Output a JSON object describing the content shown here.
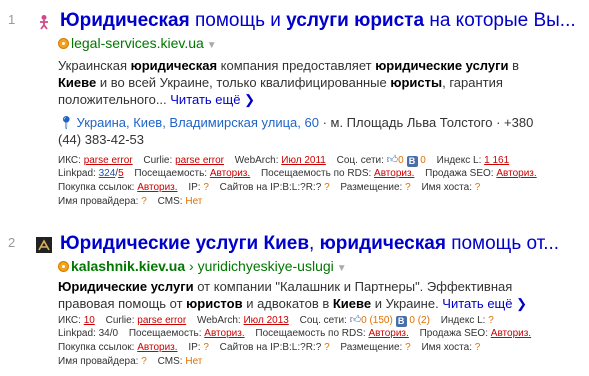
{
  "results": [
    {
      "number": "1",
      "icon": "person-favicon",
      "title_parts": [
        {
          "text": "Юридическая",
          "bold": true
        },
        {
          "text": " помощь и ",
          "bold": false
        },
        {
          "text": "услуги юриста",
          "bold": true
        },
        {
          "text": " на которые Вы...",
          "bold": false
        }
      ],
      "domain_prefix": "legal-services.kiev.ua",
      "domain_bold": "",
      "breadcrumb": "",
      "snippet_parts": [
        {
          "text": "Украинская ",
          "bold": false
        },
        {
          "text": "юридическая",
          "bold": true
        },
        {
          "text": " компания предоставляет ",
          "bold": false
        },
        {
          "text": "юридические услуги",
          "bold": true
        },
        {
          "text": " в ",
          "bold": false
        },
        {
          "text": "Киеве",
          "bold": true
        },
        {
          "text": " и во всей Украине, только квалифицированные ",
          "bold": false
        },
        {
          "text": "юристы",
          "bold": true
        },
        {
          "text": ", гарантия положительного... ",
          "bold": false
        }
      ],
      "more": "Читать ещё",
      "address_link": "Украина, Киев, Владимирская улица, 60",
      "address_rest": " · м. Площадь Льва Толстого · +380 (44) 383-42-53",
      "seo": {
        "iks": "parse error",
        "curlie": "parse error",
        "webarchive": "Июл 2011",
        "social_likes": "0",
        "social_vk": "0",
        "index_l": "1 161",
        "linkpad": "324",
        "linkpad_b": "5",
        "visits": "Авториз.",
        "rds_visits": "Авториз.",
        "seo_sale": "Авториз.",
        "buy_links": "Авториз.",
        "ip": "?",
        "ip_sites": "?",
        "placement": "?",
        "host_name": "?",
        "provider": "?",
        "cms": "Нет"
      }
    },
    {
      "number": "2",
      "icon": "scales-favicon",
      "title_parts": [
        {
          "text": "Юридические услуги Киев",
          "bold": true
        },
        {
          "text": ", ",
          "bold": false
        },
        {
          "text": "юридическая",
          "bold": true
        },
        {
          "text": " помощь от...",
          "bold": false
        }
      ],
      "domain_prefix": "",
      "domain_bold": "kalashnik.kiev.ua",
      "breadcrumb": "yuridichyeskiye-uslugi",
      "snippet_parts": [
        {
          "text": "Юридические услуги",
          "bold": true
        },
        {
          "text": " от компании \"Калашник и Партнеры\". Эффективная правовая помощь от ",
          "bold": false
        },
        {
          "text": "юристов",
          "bold": true
        },
        {
          "text": " и адвокатов в ",
          "bold": false
        },
        {
          "text": "Киеве",
          "bold": true
        },
        {
          "text": " и Украине. ",
          "bold": false
        }
      ],
      "more": "Читать ещё",
      "seo": {
        "iks": "10",
        "curlie": "parse error",
        "webarchive": "Июл 2013",
        "social_likes": "0 (150)",
        "social_vk": "0 (2)",
        "index_l": "?",
        "linkpad": "34",
        "linkpad_b": "0",
        "visits": "Авториз.",
        "rds_visits": "Авториз.",
        "seo_sale": "Авториз.",
        "buy_links": "Авториз.",
        "ip": "?",
        "ip_sites": "?",
        "placement": "?",
        "host_name": "?",
        "provider": "?",
        "cms": "Нет"
      }
    }
  ],
  "labels": {
    "iks": "ИКС:",
    "curlie": "Curlie:",
    "webarchive": "WebArch:",
    "social": "Соц. сети:",
    "index_l": "Индекс L:",
    "linkpad": "Linkpad:",
    "visits": "Посещаемость:",
    "rds_visits": "Посещаемость по RDS:",
    "seo_sale": "Продажа SEO:",
    "buy_links": "Покупка ссылок:",
    "ip": "IP:",
    "ip_sites": "Сайтов на IP:B:L:?R:?",
    "placement": "Размещение:",
    "host_name": "Имя хоста:",
    "provider": "Имя провайдера:",
    "cms": "CMS:"
  },
  "colors": {
    "title": "#0000cc",
    "domain": "#007700",
    "seo_red": "#cc0000",
    "seo_orange": "#e07000",
    "address_link": "#1e64c8"
  }
}
